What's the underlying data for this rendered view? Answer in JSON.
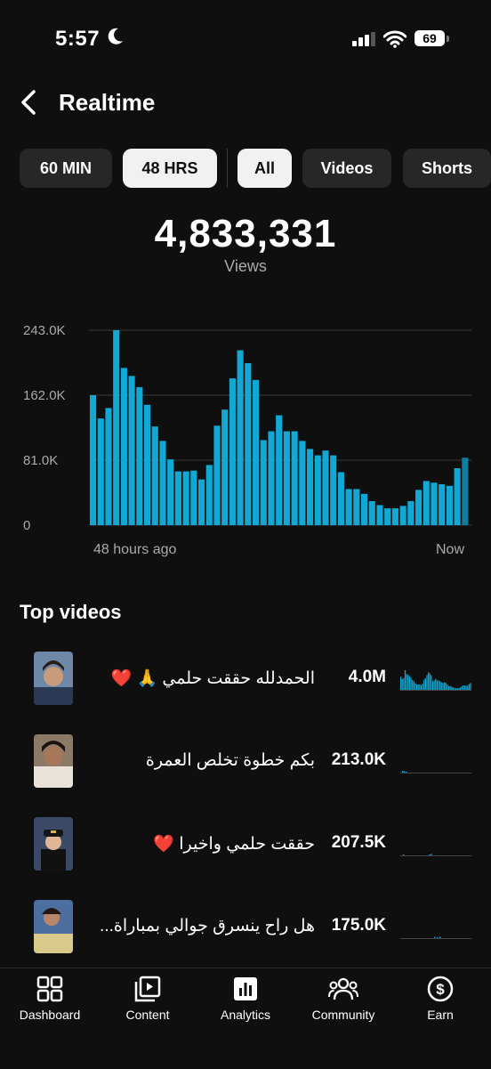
{
  "status": {
    "time": "5:57",
    "battery": "69"
  },
  "header": {
    "title": "Realtime"
  },
  "filters": {
    "time_ranges": [
      "60 MIN",
      "48 HRS"
    ],
    "content_types": [
      "All",
      "Videos",
      "Shorts"
    ]
  },
  "summary": {
    "value": "4,833,331",
    "label": "Views"
  },
  "chart_data": {
    "type": "bar",
    "y_ticks": [
      "243.0K",
      "162.0K",
      "81.0K",
      "0"
    ],
    "ylim": [
      0,
      243000
    ],
    "x_start_label": "48 hours ago",
    "x_end_label": "Now",
    "bar_color": "#12a8d4",
    "values": [
      162000,
      133000,
      146000,
      243000,
      196000,
      186000,
      172000,
      150000,
      123000,
      105000,
      82000,
      67000,
      67000,
      68000,
      57000,
      75000,
      124000,
      144000,
      183000,
      218000,
      202000,
      181000,
      106000,
      117000,
      137000,
      117000,
      117000,
      105000,
      95000,
      87000,
      93000,
      87000,
      66000,
      45000,
      45000,
      39000,
      30000,
      25000,
      21000,
      21000,
      24000,
      30000,
      44000,
      55000,
      53000,
      51000,
      49000,
      71000,
      84000
    ]
  },
  "top_videos": {
    "heading": "Top videos",
    "items": [
      {
        "title": "الحمدلله حققت حلمي 🙏 ❤️",
        "views": "4.0M"
      },
      {
        "title": "بكم خطوة تخلص العمرة",
        "views": "213.0K"
      },
      {
        "title": "حققت حلمي واخيرا ❤️",
        "views": "207.5K"
      },
      {
        "title": "هل راح ينسرق جوالي بمباراة...",
        "views": "175.0K"
      }
    ]
  },
  "nav": {
    "items": [
      {
        "label": "Dashboard",
        "icon": "dashboard-icon"
      },
      {
        "label": "Content",
        "icon": "content-icon"
      },
      {
        "label": "Analytics",
        "icon": "analytics-icon"
      },
      {
        "label": "Community",
        "icon": "community-icon"
      },
      {
        "label": "Earn",
        "icon": "earn-icon"
      }
    ]
  }
}
